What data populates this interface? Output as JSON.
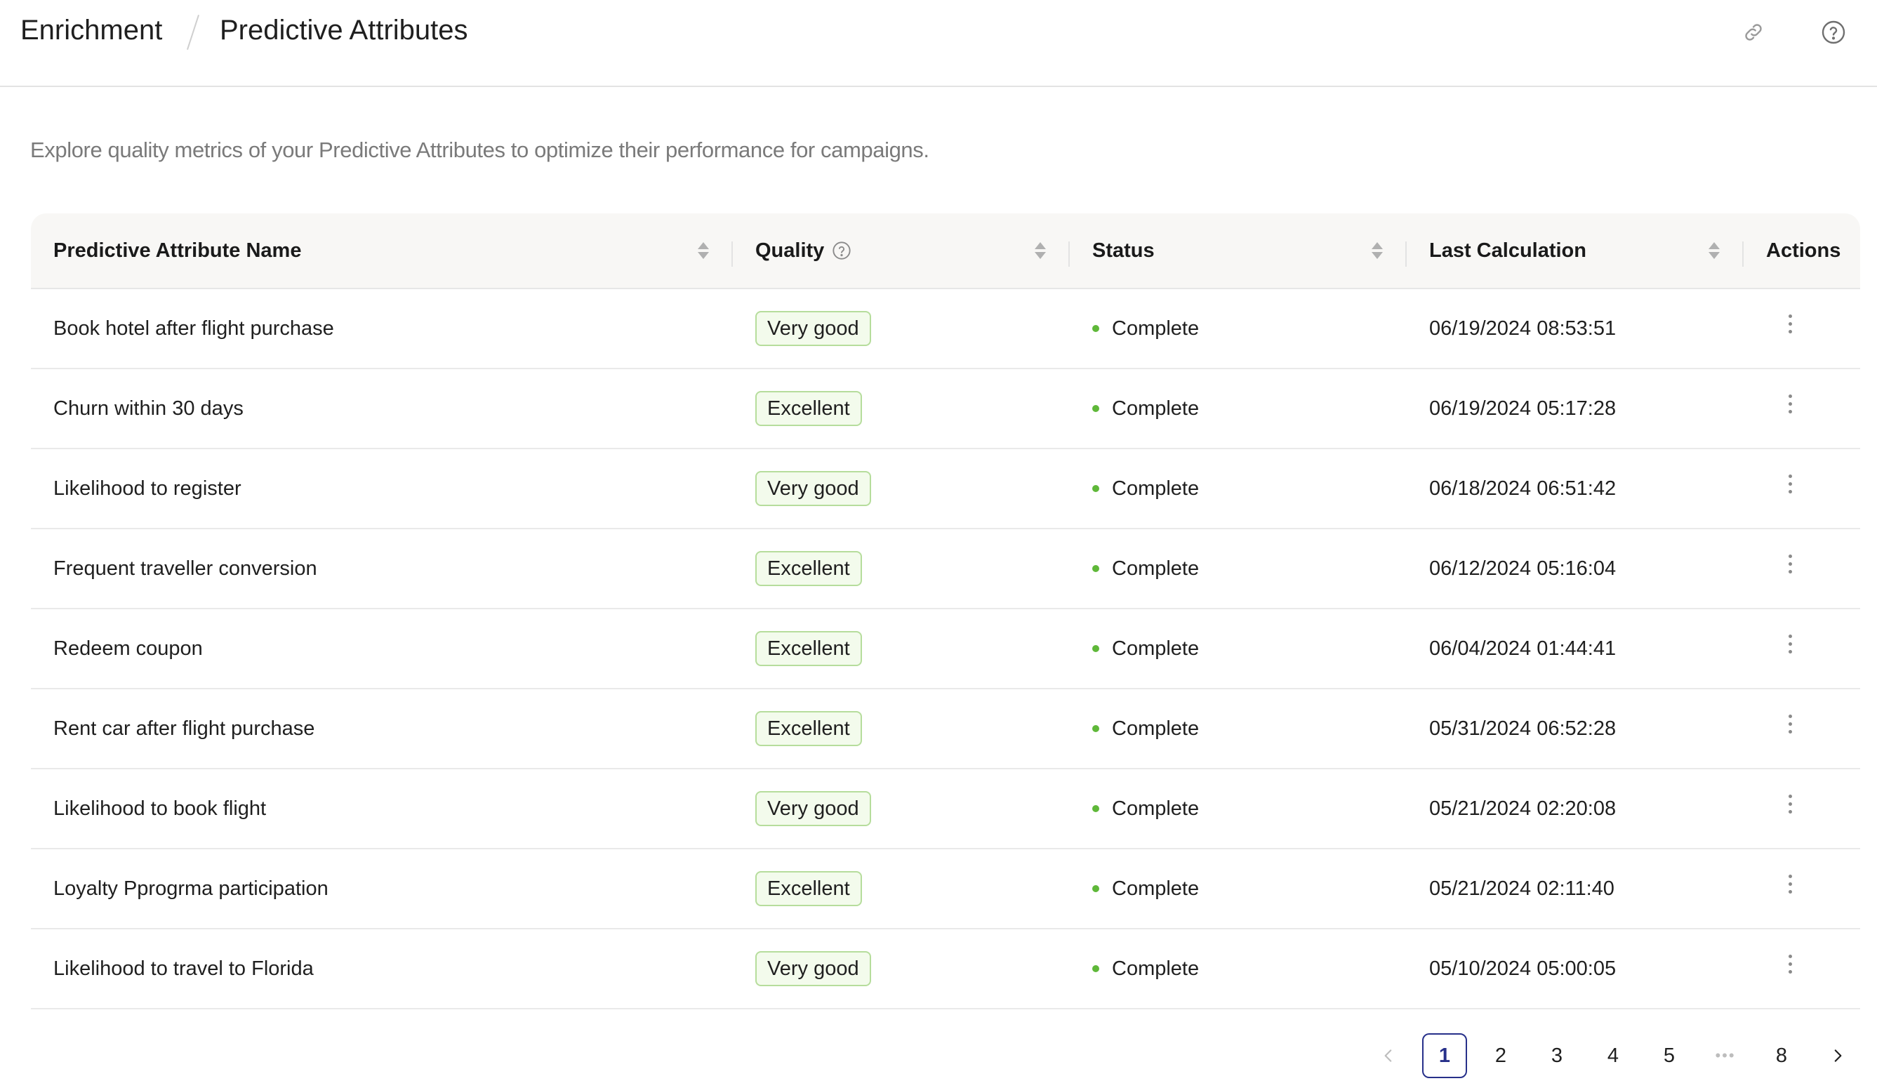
{
  "header": {
    "breadcrumb_root": "Enrichment",
    "breadcrumb_current": "Predictive Attributes"
  },
  "description": "Explore quality metrics of your Predictive Attributes to optimize their performance for campaigns.",
  "table": {
    "columns": {
      "name": "Predictive Attribute Name",
      "quality": "Quality",
      "status": "Status",
      "last_calculation": "Last Calculation",
      "actions": "Actions"
    },
    "rows": [
      {
        "name": "Book hotel after flight purchase",
        "quality": "Very good",
        "status": "Complete",
        "last_calculation": "06/19/2024 08:53:51"
      },
      {
        "name": "Churn within 30 days",
        "quality": "Excellent",
        "status": "Complete",
        "last_calculation": "06/19/2024 05:17:28"
      },
      {
        "name": "Likelihood to register",
        "quality": "Very good",
        "status": "Complete",
        "last_calculation": "06/18/2024 06:51:42"
      },
      {
        "name": "Frequent traveller conversion",
        "quality": "Excellent",
        "status": "Complete",
        "last_calculation": "06/12/2024 05:16:04"
      },
      {
        "name": "Redeem coupon",
        "quality": "Excellent",
        "status": "Complete",
        "last_calculation": "06/04/2024 01:44:41"
      },
      {
        "name": "Rent car after flight purchase",
        "quality": "Excellent",
        "status": "Complete",
        "last_calculation": "05/31/2024 06:52:28"
      },
      {
        "name": "Likelihood to book flight",
        "quality": "Very good",
        "status": "Complete",
        "last_calculation": "05/21/2024 02:20:08"
      },
      {
        "name": "Loyalty Pprogrma participation",
        "quality": "Excellent",
        "status": "Complete",
        "last_calculation": "05/21/2024 02:11:40"
      },
      {
        "name": "Likelihood to travel to Florida",
        "quality": "Very good",
        "status": "Complete",
        "last_calculation": "05/10/2024 05:00:05"
      }
    ]
  },
  "pagination": {
    "pages": [
      "1",
      "2",
      "3",
      "4",
      "5",
      "8"
    ],
    "current": "1",
    "ellipsis": "•••"
  },
  "colors": {
    "badge_border": "#b6dd9c",
    "badge_bg": "#f3fbec",
    "status_dot": "#5fb839",
    "active_page": "#27308a"
  },
  "icons": {
    "header_link": "link-icon",
    "header_help": "help-circle-icon",
    "quality_help": "help-circle-icon",
    "row_actions": "kebab-menu-icon",
    "pager_prev": "chevron-left-icon",
    "pager_next": "chevron-right-icon"
  }
}
